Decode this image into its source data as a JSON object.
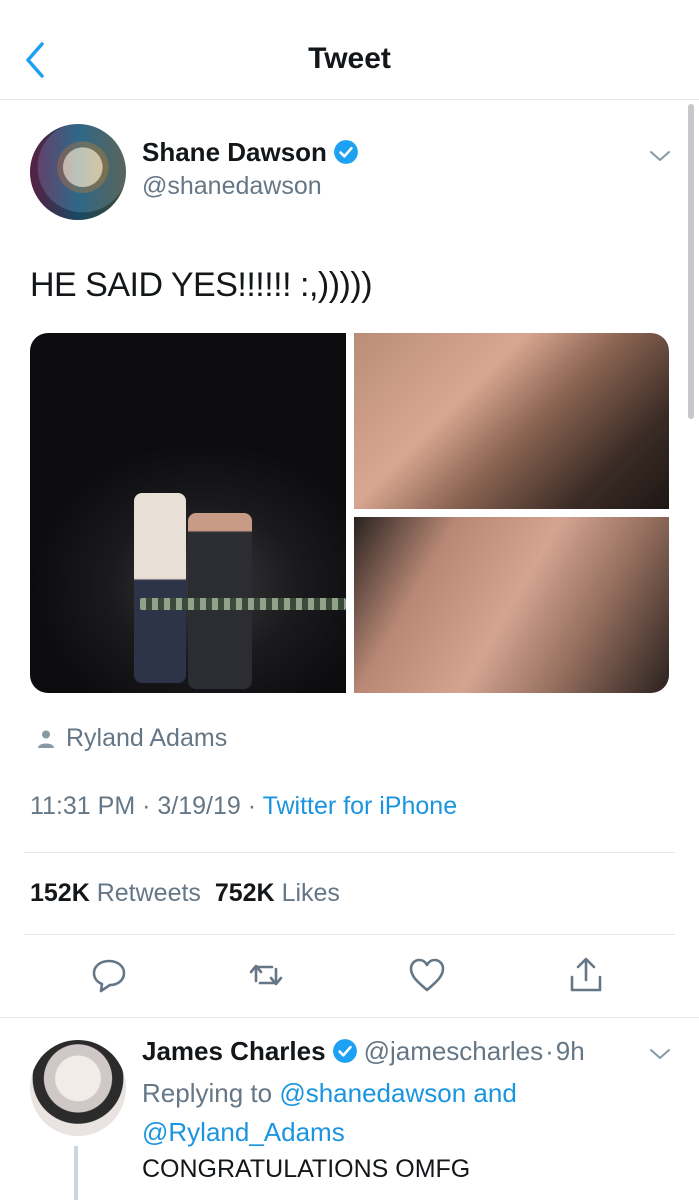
{
  "nav": {
    "title": "Tweet",
    "back_icon": "chevron-left-icon"
  },
  "tweet": {
    "author_name": "Shane Dawson",
    "author_handle": "@shanedawson",
    "verified": true,
    "text": "HE SAID YES!!!!!! :,)))))",
    "tagged_person": "Ryland Adams",
    "time": "11:31 PM",
    "date": "3/19/19",
    "source": "Twitter for iPhone",
    "retweets_count": "152K",
    "retweets_label": "Retweets",
    "likes_count": "752K",
    "likes_label": "Likes",
    "actions": [
      "reply-icon",
      "retweet-icon",
      "like-icon",
      "share-icon"
    ]
  },
  "reply": {
    "author_name": "James Charles",
    "author_handle": "@jamescharles",
    "time_ago": "9h",
    "replying_prefix": "Replying to",
    "replying_to_1": "@shanedawson",
    "replying_conj": "and",
    "replying_to_2": "@Ryland_Adams",
    "text": "CONGRATULATIONS OMFG"
  },
  "colors": {
    "accent": "#1b95e0",
    "secondary_text": "#657786",
    "primary_text": "#14171a",
    "divider": "#e1e8ed",
    "verified": "#1da1f2"
  }
}
